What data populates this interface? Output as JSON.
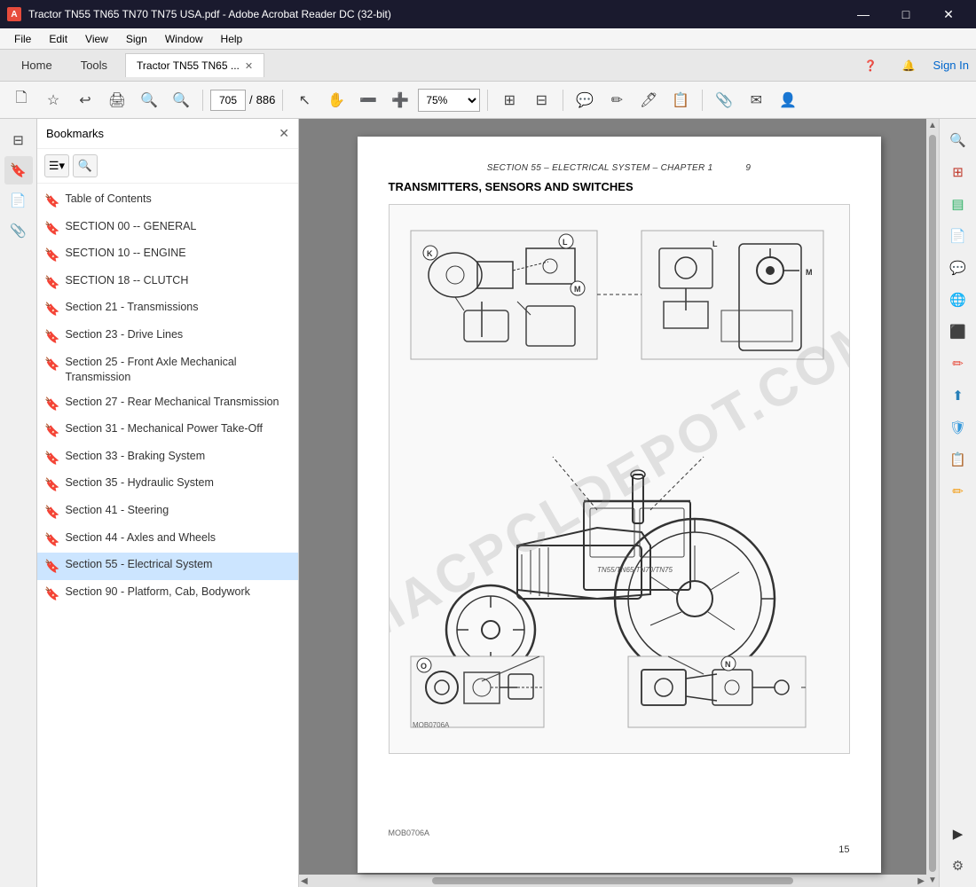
{
  "app": {
    "title": "Tractor TN55 TN65 TN70 TN75 USA.pdf - Adobe Acrobat Reader DC (32-bit)",
    "tab_label": "Tractor TN55 TN65 ...",
    "minimize": "—",
    "maximize": "□",
    "close": "✕"
  },
  "menu": {
    "items": [
      "File",
      "Edit",
      "View",
      "Sign",
      "Window",
      "Help"
    ]
  },
  "tabs": {
    "home": "Home",
    "tools": "Tools",
    "signin": "Sign In"
  },
  "toolbar": {
    "page_current": "705",
    "page_total": "886",
    "zoom": "75%"
  },
  "bookmarks": {
    "title": "Bookmarks",
    "items": [
      {
        "label": "Table of Contents",
        "active": false
      },
      {
        "label": "SECTION 00 -- GENERAL",
        "active": false
      },
      {
        "label": "SECTION 10 -- ENGINE",
        "active": false
      },
      {
        "label": "SECTION 18 -- CLUTCH",
        "active": false
      },
      {
        "label": "Section 21 - Transmissions",
        "active": false
      },
      {
        "label": "Section 23 - Drive Lines",
        "active": false
      },
      {
        "label": "Section 25 - Front Axle Mechanical Transmission",
        "active": false
      },
      {
        "label": "Section 27 - Rear Mechanical Transmission",
        "active": false
      },
      {
        "label": "Section 31 - Mechanical Power Take-Off",
        "active": false
      },
      {
        "label": "Section 33 - Braking System",
        "active": false
      },
      {
        "label": "Section 35 - Hydraulic System",
        "active": false
      },
      {
        "label": "Section 41 - Steering",
        "active": false
      },
      {
        "label": "Section 44 - Axles and Wheels",
        "active": false
      },
      {
        "label": "Section 55 - Electrical System",
        "active": true
      },
      {
        "label": "Section 90 - Platform, Cab, Bodywork",
        "active": false
      }
    ]
  },
  "pdf": {
    "header": "SECTION 55 – ELECTRICAL SYSTEM – CHAPTER 1",
    "page_number": "9",
    "section_title": "TRANSMITTERS, SENSORS AND SWITCHES",
    "figure_label": "MOB0706A",
    "page_num_bottom": "15",
    "watermark": "MACPCLDEPOT.COM"
  },
  "colors": {
    "active_bookmark": "#cce5ff",
    "bookmark_icon": "#e67e22",
    "accent_blue": "#0066cc"
  }
}
